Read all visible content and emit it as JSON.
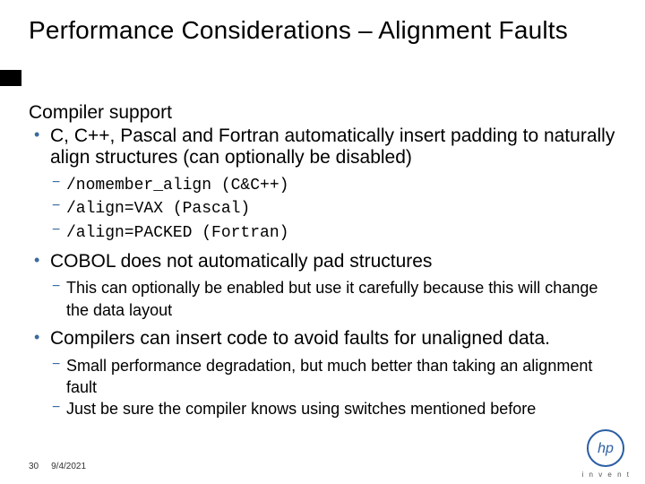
{
  "title": "Performance Considerations – Alignment Faults",
  "heading": "Compiler support",
  "bullet1": "C, C++, Pascal and Fortran automatically insert padding to naturally align structures (can optionally be disabled)",
  "switches": [
    "/nomember_align (C&C++)",
    "/align=VAX (Pascal)",
    "/align=PACKED (Fortran)"
  ],
  "bullet2": "COBOL does not automatically pad structures",
  "sub2": [
    "This can optionally be enabled but use it carefully because this will change the data layout"
  ],
  "bullet3": "Compilers can insert code to avoid faults for unaligned data.",
  "sub3": [
    "Small performance degradation, but much better than taking an alignment fault",
    "Just be sure the compiler knows using switches mentioned before"
  ],
  "footer": {
    "page": "30",
    "date": "9/4/2021"
  },
  "logo": {
    "label": "hp",
    "tagline": "i n v e n t"
  }
}
